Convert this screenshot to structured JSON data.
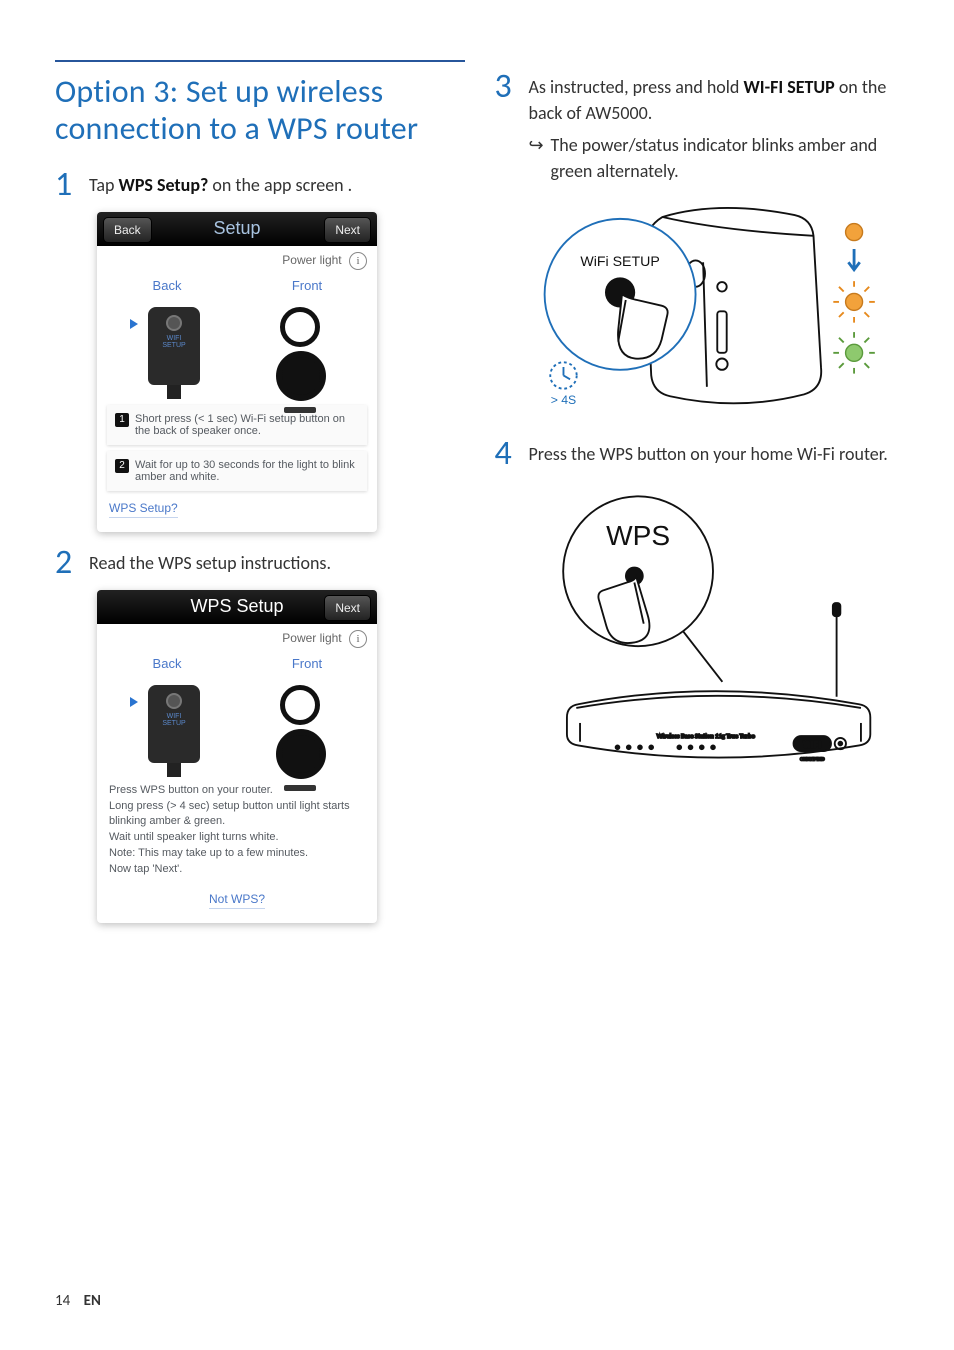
{
  "section_title": "Option 3: Set up wireless connection to a WPS router",
  "steps": {
    "s1": {
      "num": "1",
      "pre": "Tap ",
      "bold": "WPS Setup?",
      "post": " on the app screen ."
    },
    "s2": {
      "num": "2",
      "text": "Read the WPS setup instructions."
    },
    "s3": {
      "num": "3",
      "pre": "As instructed, press and hold ",
      "bold": "WI-FI SETUP",
      "post": " on the back of AW5000.",
      "sub": "The power/status indicator blinks amber and green alternately."
    },
    "s4": {
      "num": "4",
      "text": "Press the WPS button on your home Wi-Fi router."
    }
  },
  "app1": {
    "back_btn": "Back",
    "title": "Setup",
    "next_btn": "Next",
    "power_light": "Power light",
    "tab_back": "Back",
    "tab_front": "Front",
    "speaker_lbl": "WIFI\nSETUP",
    "instr1": "Short press (< 1 sec) Wi-Fi setup button on the back of speaker once.",
    "instr2": "Wait for up to 30 seconds for the light to blink amber and white.",
    "link": "WPS Setup?"
  },
  "app2": {
    "title": "WPS Setup",
    "next_btn": "Next",
    "power_light": "Power light",
    "tab_back": "Back",
    "tab_front": "Front",
    "speaker_lbl": "WIFI\nSETUP",
    "para": "Press WPS button on your router.\nLong press (> 4 sec) setup button until light starts blinking amber & green.\nWait until speaker light turns white.\nNote: This may take up to a few minutes.\nNow tap 'Next'.",
    "link": "Not WPS?"
  },
  "fig1": {
    "callout": "WiFi SETUP",
    "timer": "> 4S"
  },
  "fig2": {
    "bubble": "WPS",
    "router_label": "Wireless Base Station 11g True Turbo",
    "wifi_badge": "WIFI",
    "cert": "CERTIFIED"
  },
  "footer": {
    "page": "14",
    "lang": "EN"
  }
}
